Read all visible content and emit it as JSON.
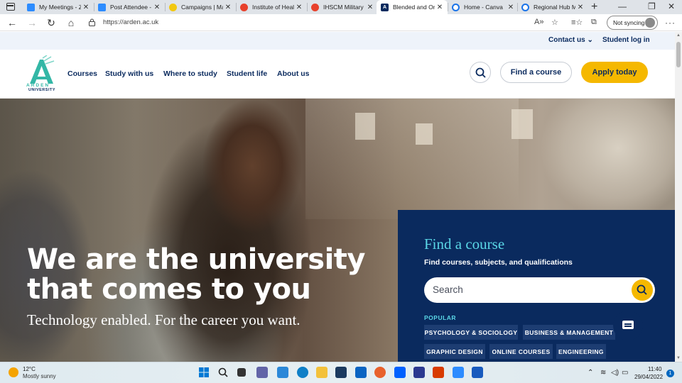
{
  "browser": {
    "tabs": [
      {
        "title": "My Meetings - Zo",
        "favicon": "zoom-icon"
      },
      {
        "title": "Post Attendee - Z",
        "favicon": "zoom-icon"
      },
      {
        "title": "Campaigns | Mai",
        "favicon": "campaign-icon"
      },
      {
        "title": "Institute of Healt",
        "favicon": "edge-icon"
      },
      {
        "title": "IHSCM Military Sc",
        "favicon": "edge-icon"
      },
      {
        "title": "Blended and Onli",
        "favicon": "arden-icon",
        "active": true
      },
      {
        "title": "Home - Canva",
        "favicon": "chrome-icon"
      },
      {
        "title": "Regional Hub Ma",
        "favicon": "chrome-icon"
      }
    ],
    "url": "https://arden.ac.uk",
    "sync_label": "Not syncing"
  },
  "site": {
    "utility": {
      "contact": "Contact us ⌄",
      "login": "Student log in"
    },
    "logo": {
      "line1": "ARDEN",
      "line2": "UNIVERSITY"
    },
    "menu": [
      "Courses",
      "Study with us",
      "Where to study",
      "Student life",
      "About us"
    ],
    "find_course_btn": "Find a course",
    "apply_btn": "Apply today",
    "hero": {
      "title_line1": "We are the university",
      "title_line2": "that comes to you",
      "subtitle": "Technology enabled. For the career you want."
    },
    "course_panel": {
      "title": "Find a course",
      "subtitle": "Find courses, subjects, and qualifications",
      "search_placeholder": "Search",
      "popular_label": "POPULAR",
      "chips": [
        "PSYCHOLOGY & SOCIOLOGY",
        "BUSINESS & MANAGEMENT",
        "GRAPHIC DESIGN",
        "ONLINE COURSES",
        "ENGINEERING"
      ]
    },
    "colors": {
      "navy": "#0a2a5e",
      "accent_yellow": "#f5b800",
      "teal": "#5ad6e6"
    }
  },
  "taskbar": {
    "weather_temp": "12°C",
    "weather_desc": "Mostly sunny",
    "time": "11:40",
    "date": "29/04/2022",
    "notification_count": "1"
  }
}
